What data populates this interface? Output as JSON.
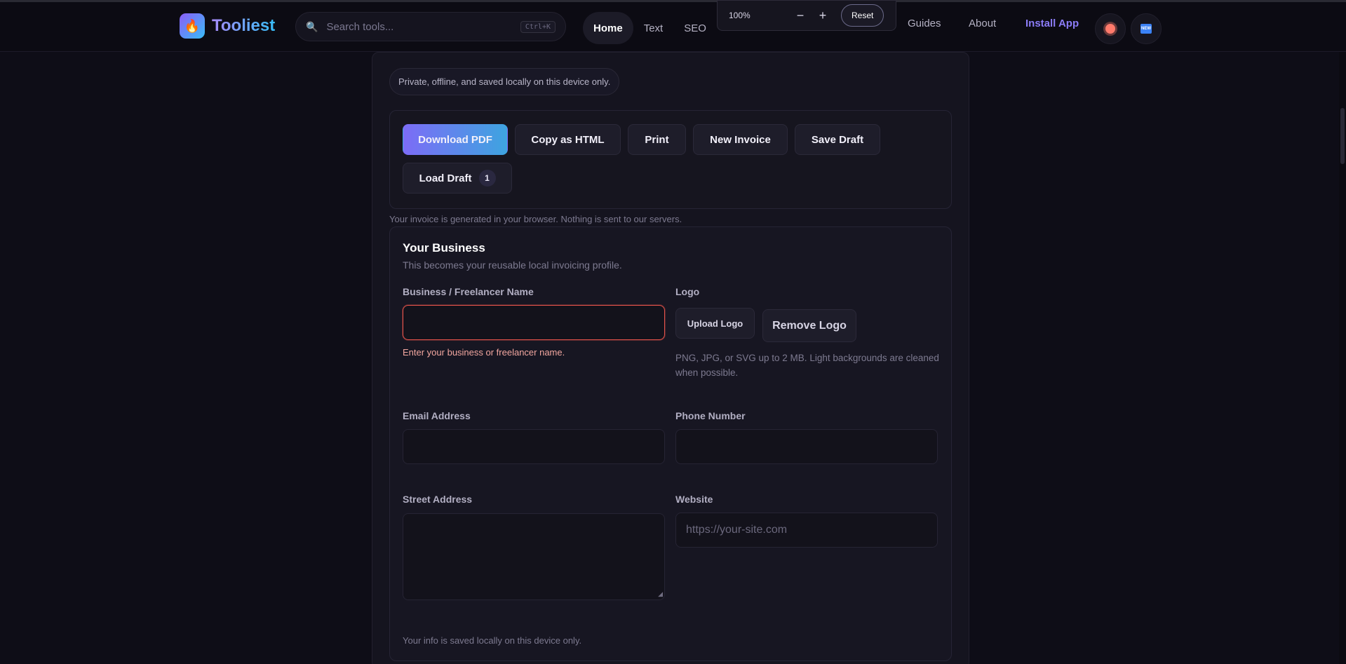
{
  "brand": {
    "name": "Tooliest",
    "logo_glyph": "🔥"
  },
  "search": {
    "placeholder": "Search tools...",
    "shortcut": "Ctrl+K"
  },
  "nav": {
    "home": "Home",
    "text": "Text",
    "seo": "SEO",
    "guides": "Guides",
    "about": "About",
    "install": "Install App"
  },
  "zoom": {
    "level": "100%",
    "minus": "−",
    "plus": "+",
    "reset": "Reset"
  },
  "privacy_pill": "Private, offline, and saved locally on this device only.",
  "actions": {
    "download_pdf": "Download PDF",
    "copy_html": "Copy as HTML",
    "print": "Print",
    "new_invoice": "New Invoice",
    "save_draft": "Save Draft",
    "load_draft": "Load Draft",
    "draft_count": "1"
  },
  "generated_note": "Your invoice is generated in your browser. Nothing is sent to our servers.",
  "business": {
    "title": "Your Business",
    "subtitle": "This becomes your reusable local invoicing profile.",
    "name_label": "Business / Freelancer Name",
    "name_value": "",
    "name_error": "Enter your business or freelancer name.",
    "logo_label": "Logo",
    "upload_logo": "Upload Logo",
    "remove_logo": "Remove Logo",
    "logo_help": "PNG, JPG, or SVG up to 2 MB. Light backgrounds are cleaned when possible.",
    "email_label": "Email Address",
    "email_value": "",
    "phone_label": "Phone Number",
    "phone_value": "",
    "street_label": "Street Address",
    "street_value": "",
    "website_label": "Website",
    "website_placeholder": "https://your-site.com",
    "saved_note": "Your info is saved locally on this device only."
  },
  "colors": {
    "accent_start": "#7c6cf6",
    "accent_end": "#3ea4e0",
    "error": "#e5534b",
    "background": "#0e0d17"
  }
}
